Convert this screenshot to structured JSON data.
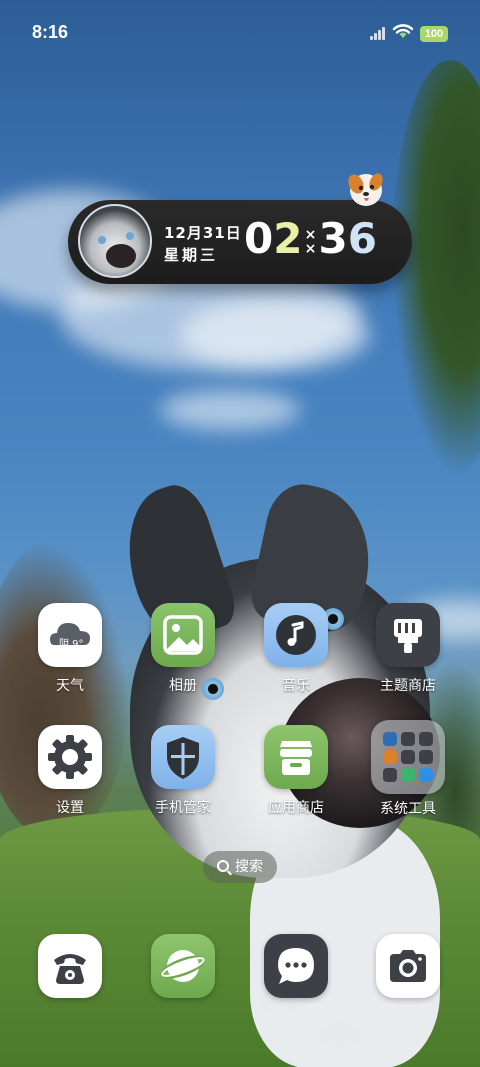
{
  "status_bar": {
    "time": "8:16",
    "battery": "100",
    "battery_color": "#a8d86b"
  },
  "widget": {
    "date": "12月31日",
    "weekday": "星期三",
    "hour_tens": "0",
    "hour_ones": "2",
    "minute_tens": "3",
    "minute_ones": "6",
    "separator": "×",
    "background": "#1f1e1e"
  },
  "apps_row1": [
    {
      "label": "天气",
      "icon": "weather-icon",
      "badge_text": "阴 9°"
    },
    {
      "label": "相册",
      "icon": "gallery-icon"
    },
    {
      "label": "音乐",
      "icon": "music-icon"
    },
    {
      "label": "主题商店",
      "icon": "theme-store-icon"
    }
  ],
  "apps_row2": [
    {
      "label": "设置",
      "icon": "gear-icon"
    },
    {
      "label": "手机管家",
      "icon": "shield-icon"
    },
    {
      "label": "应用商店",
      "icon": "app-store-icon"
    },
    {
      "label": "系统工具",
      "icon": "folder-icon"
    }
  ],
  "search": {
    "label": "搜索"
  },
  "dock": [
    {
      "name": "phone",
      "icon": "phone-icon"
    },
    {
      "name": "browser",
      "icon": "browser-icon"
    },
    {
      "name": "messages",
      "icon": "message-icon"
    },
    {
      "name": "camera",
      "icon": "camera-icon"
    }
  ],
  "colors": {
    "accent_green": "#6ea94f",
    "accent_blue": "#7fb2ea",
    "dark_tile": "#3d4046"
  }
}
